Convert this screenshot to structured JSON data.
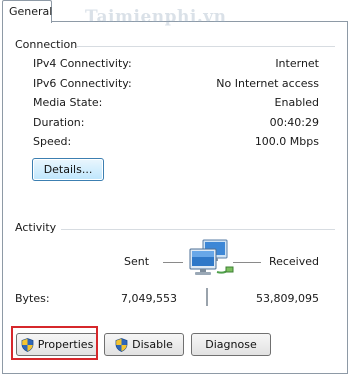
{
  "tab": {
    "label": "General"
  },
  "watermark": "Taimienphi.vn",
  "connection": {
    "title": "Connection",
    "rows": [
      {
        "label": "IPv4 Connectivity:",
        "value": "Internet"
      },
      {
        "label": "IPv6 Connectivity:",
        "value": "No Internet access"
      },
      {
        "label": "Media State:",
        "value": "Enabled"
      },
      {
        "label": "Duration:",
        "value": "00:40:29"
      },
      {
        "label": "Speed:",
        "value": "100.0 Mbps"
      }
    ],
    "details_label": "Details..."
  },
  "activity": {
    "title": "Activity",
    "sent_label": "Sent",
    "received_label": "Received",
    "bytes_label": "Bytes:",
    "bytes_sent": "7,049,553",
    "bytes_received": "53,809,095"
  },
  "buttons": {
    "properties": "Properties",
    "disable": "Disable",
    "diagnose": "Diagnose"
  },
  "colors": {
    "highlight": "#d6272b",
    "accent_blue": "#3c7fb1"
  }
}
